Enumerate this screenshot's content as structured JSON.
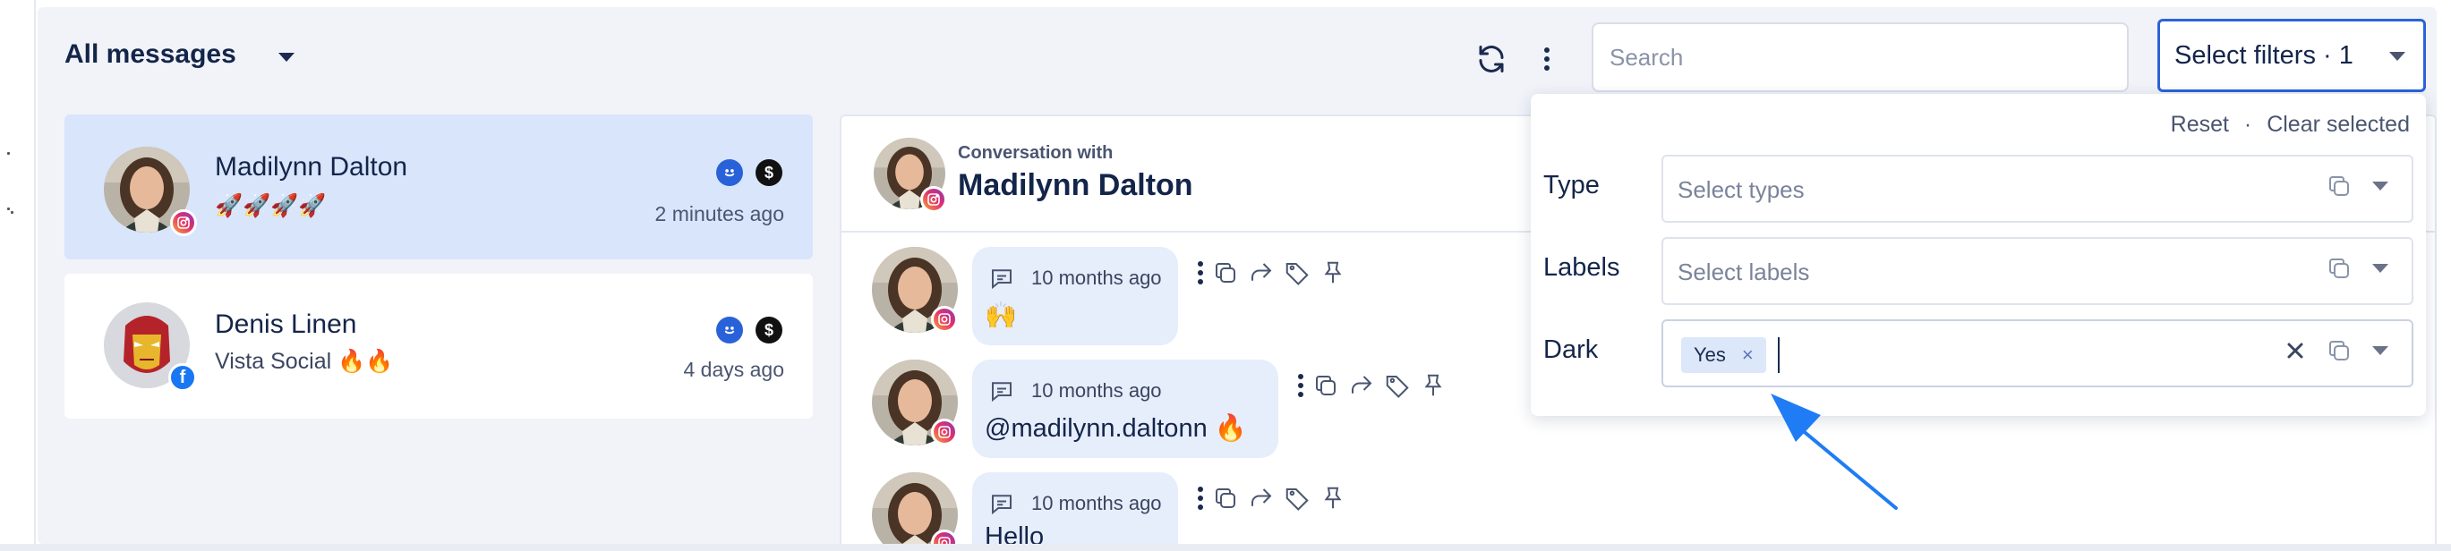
{
  "header": {
    "title": "All messages",
    "search_placeholder": "Search",
    "filter_button_label": "Select filters · 1"
  },
  "conversations": [
    {
      "name": "Madilynn Dalton",
      "preview": "🚀🚀🚀🚀",
      "time": "2 minutes ago",
      "network": "instagram",
      "active": true
    },
    {
      "name": "Denis Linen",
      "preview": "Vista Social 🔥🔥",
      "time": "4 days ago",
      "network": "facebook",
      "active": false
    }
  ],
  "thread": {
    "subtitle": "Conversation with",
    "name": "Madilynn Dalton",
    "messages": [
      {
        "time": "10 months ago",
        "text": "🙌"
      },
      {
        "time": "10 months ago",
        "text": "@madilynn.daltonn 🔥"
      },
      {
        "time": "10 months ago",
        "text": "Hello"
      }
    ]
  },
  "filter_dropdown": {
    "reset_label": "Reset",
    "separator": "·",
    "clear_label": "Clear selected",
    "fields": [
      {
        "label": "Type",
        "placeholder": "Select types"
      },
      {
        "label": "Labels",
        "placeholder": "Select labels"
      },
      {
        "label": "Dark",
        "chip": "Yes",
        "chip_remove": "×"
      }
    ]
  },
  "colors": {
    "accent": "#2b63d9",
    "active_row": "#d9e5fb",
    "bubble": "#e6edfb",
    "annotation_arrow": "#1f7cf5",
    "smile_badge": "#2962d8",
    "dollar_badge": "#111111"
  },
  "icons": {
    "dropdown": "chevron-down-icon",
    "refresh": "refresh-icon",
    "more": "kebab-icon",
    "clear": "clear-x-icon",
    "copy": "copy-icon",
    "reply": "reply-icon",
    "share": "share-icon",
    "tag": "tag-icon",
    "pin": "pin-icon",
    "comment": "comment-icon"
  }
}
